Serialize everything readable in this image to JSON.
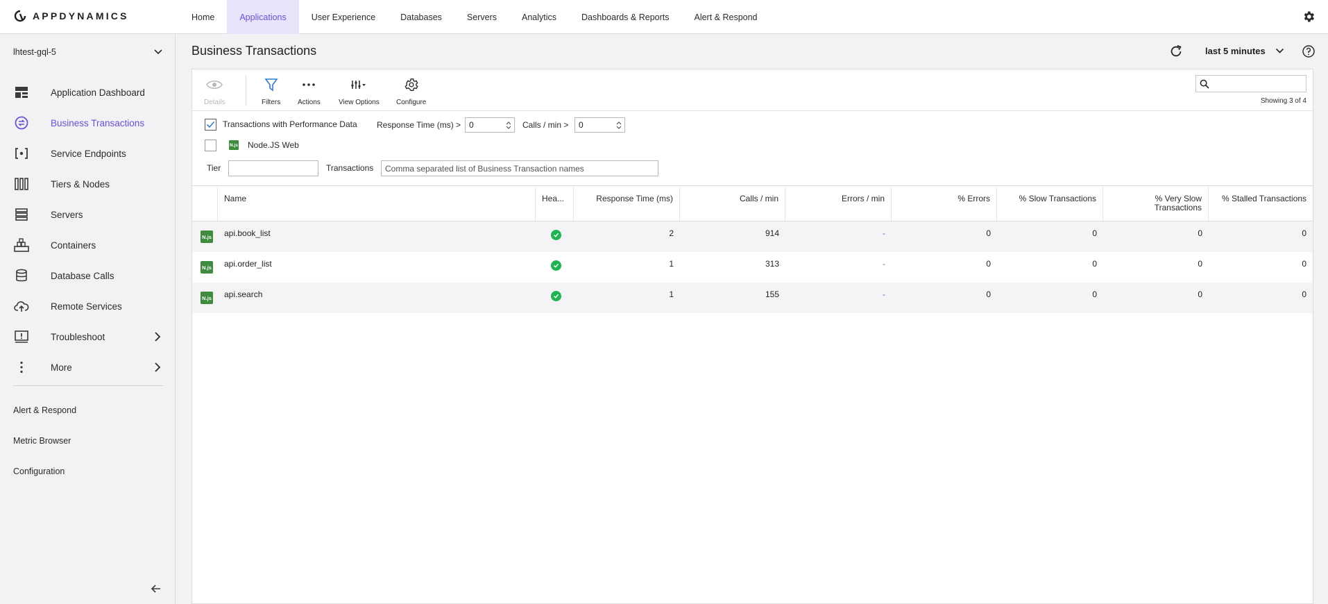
{
  "brand": {
    "name": "APPDYNAMICS"
  },
  "nav": {
    "items": [
      {
        "label": "Home"
      },
      {
        "label": "Applications"
      },
      {
        "label": "User Experience"
      },
      {
        "label": "Databases"
      },
      {
        "label": "Servers"
      },
      {
        "label": "Analytics"
      },
      {
        "label": "Dashboards & Reports"
      },
      {
        "label": "Alert & Respond"
      }
    ],
    "active": "Applications"
  },
  "sidebar": {
    "application": "lhtest-gql-5",
    "items": [
      {
        "label": "Application Dashboard",
        "icon": "dashboard-icon"
      },
      {
        "label": "Business Transactions",
        "icon": "business-transactions-icon"
      },
      {
        "label": "Service Endpoints",
        "icon": "service-endpoints-icon"
      },
      {
        "label": "Tiers & Nodes",
        "icon": "tiers-nodes-icon"
      },
      {
        "label": "Servers",
        "icon": "servers-icon"
      },
      {
        "label": "Containers",
        "icon": "containers-icon"
      },
      {
        "label": "Database Calls",
        "icon": "database-icon"
      },
      {
        "label": "Remote Services",
        "icon": "cloud-upload-icon"
      },
      {
        "label": "Troubleshoot",
        "icon": "troubleshoot-icon"
      },
      {
        "label": "More",
        "icon": "more-vertical-icon"
      }
    ],
    "active": "Business Transactions",
    "links": [
      {
        "label": "Alert & Respond"
      },
      {
        "label": "Metric Browser"
      },
      {
        "label": "Configuration"
      }
    ]
  },
  "main": {
    "title": "Business Transactions",
    "time_range": "last 5 minutes",
    "accent_color": "#6b4fe0"
  },
  "toolbar": {
    "details": "Details",
    "filters": "Filters",
    "actions": "Actions",
    "view_options": "View Options",
    "configure": "Configure",
    "search_placeholder": "",
    "showing": "Showing 3 of 4"
  },
  "filters": {
    "perf_data_label": "Transactions with Performance Data",
    "perf_data_checked": true,
    "response_time_label": "Response Time (ms) >",
    "response_time_value": "0",
    "calls_label": "Calls / min >",
    "calls_value": "0",
    "node_badge": "N.js",
    "node_label": "Node.JS Web",
    "tier_label": "Tier",
    "tier_value": "",
    "transactions_label": "Transactions",
    "transactions_placeholder": "Comma separated list of Business Transaction names"
  },
  "table": {
    "columns": [
      "",
      "Name",
      "Hea...",
      "Response Time (ms)",
      "Calls / min",
      "Errors / min",
      "% Errors",
      "% Slow Transactions",
      "% Very Slow Transactions",
      "% Stalled Transactions"
    ],
    "rows": [
      {
        "badge": "N.js",
        "name": "api.book_list",
        "health": "ok",
        "response_time": "2",
        "calls": "914",
        "errors": "-",
        "pct_errors": "0",
        "pct_slow": "0",
        "pct_very_slow": "0",
        "pct_stalled": "0"
      },
      {
        "badge": "N.js",
        "name": "api.order_list",
        "health": "ok",
        "response_time": "1",
        "calls": "313",
        "errors": "-",
        "pct_errors": "0",
        "pct_slow": "0",
        "pct_very_slow": "0",
        "pct_stalled": "0"
      },
      {
        "badge": "N.js",
        "name": "api.search",
        "health": "ok",
        "response_time": "1",
        "calls": "155",
        "errors": "-",
        "pct_errors": "0",
        "pct_slow": "0",
        "pct_very_slow": "0",
        "pct_stalled": "0"
      }
    ]
  }
}
